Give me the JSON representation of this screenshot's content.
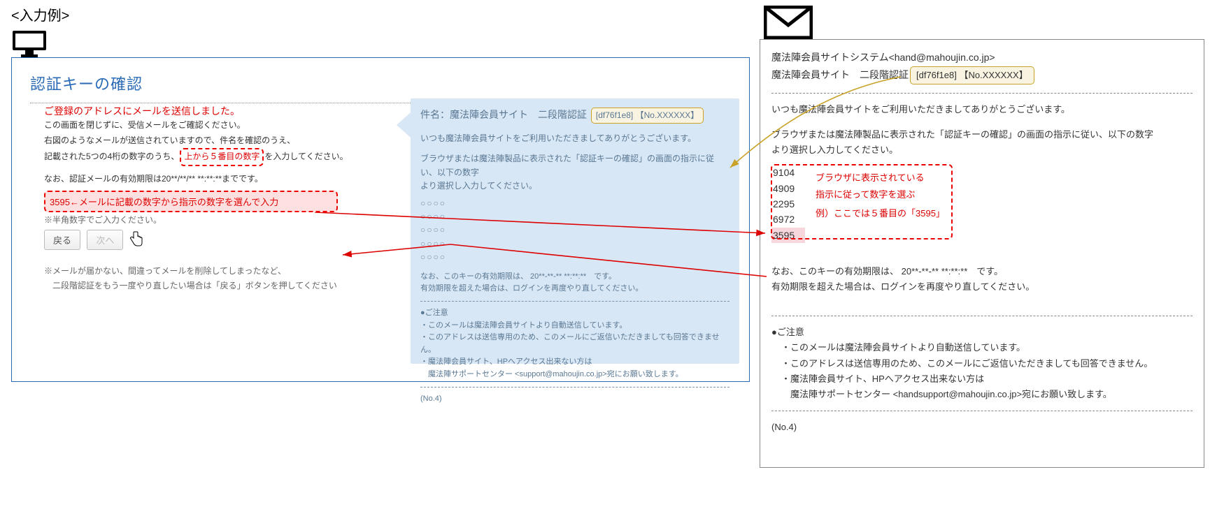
{
  "header": {
    "example_label": "<入力例>"
  },
  "browser": {
    "title": "認証キーの確認",
    "sent_notice": "ご登録のアドレスにメールを送信しました。",
    "line1": "この画面を閉じずに、受信メールをご確認ください。",
    "line2": "右図のようなメールが送信されていますので、件名を確認のうえ、",
    "line3a": "記載された5つの4桁の数字のうち、",
    "line3_red": "上から５番目の数字",
    "line3b": "を入力してください。",
    "expiry": "なお、認証メールの有効期限は20**/**/**  **:**:**までです。",
    "pink_input": "3595←メールに記載の数字から指示の数字を選んで入力",
    "hankaku": "※半角数字でご入力ください。",
    "btn_back": "戻る",
    "btn_next": "次へ",
    "note_l1": "※メールが届かない、間違ってメールを削除してしまったなど、",
    "note_l2": "　二段階認証をもう一度やり直したい場合は「戻る」ボタンを押してください"
  },
  "email_preview": {
    "subj_prefix": "件名：魔法陣会員サイト　二段階認証",
    "badge": "[df76f1e8] 【No.XXXXXX】",
    "greet": "いつも魔法陣会員サイトをご利用いただきましてありがとうございます。",
    "instr_l1": "ブラウザまたは魔法陣製品に表示された「認証キーの確認」の画面の指示に従い、以下の数字",
    "instr_l2": "より選択し入力してください。",
    "circles": [
      "○○○○",
      "○○○○",
      "○○○○",
      "○○○○",
      "○○○○"
    ],
    "exp_l1": "なお、このキーの有効期限は、 20**-**-**  **:**:**　です。",
    "exp_l2": "有効期限を超えた場合は、ログインを再度やり直してください。",
    "caution_h": "●ご注意",
    "c1": "・このメールは魔法陣会員サイトより自動送信しています。",
    "c2": "・このアドレスは送信専用のため、このメールにご返信いただきましても回答できません。",
    "c3": "・魔法陣会員サイト、HPへアクセス出来ない方は",
    "c4": "　魔法陣サポートセンター <support@mahoujin.co.jp>宛にお願い致します。",
    "no": "(No.4)"
  },
  "mail": {
    "from": "魔法陣会員サイトシステム<hand@mahoujin.co.jp>",
    "subj_prefix": "魔法陣会員サイト　二段階認証",
    "badge": "[df76f1e8] 【No.XXXXXX】",
    "greet": "いつも魔法陣会員サイトをご利用いただきましてありがとうございます。",
    "instr_l1": "ブラウザまたは魔法陣製品に表示された「認証キーの確認」の画面の指示に従い、以下の数字",
    "instr_l2": "より選択し入力してください。",
    "numbers": [
      "9104",
      "4909",
      "2295",
      "6972",
      "3595"
    ],
    "guide_l1": "ブラウザに表示されている",
    "guide_l2": "指示に従って数字を選ぶ",
    "guide_l3": "例）ここでは５番目の「3595」",
    "exp_l1": "なお、このキーの有効期限は、 20**-**-**  **:**:**　です。",
    "exp_l2": "有効期限を超えた場合は、ログインを再度やり直してください。",
    "caution_h": "●ご注意",
    "c1": "・このメールは魔法陣会員サイトより自動送信しています。",
    "c2": "・このアドレスは送信専用のため、このメールにご返信いただきましても回答できません。",
    "c3": "・魔法陣会員サイト、HPへアクセス出来ない方は",
    "c4": "　魔法陣サポートセンター <handsupport@mahoujin.co.jp>宛にお願い致します。",
    "no": "(No.4)"
  }
}
